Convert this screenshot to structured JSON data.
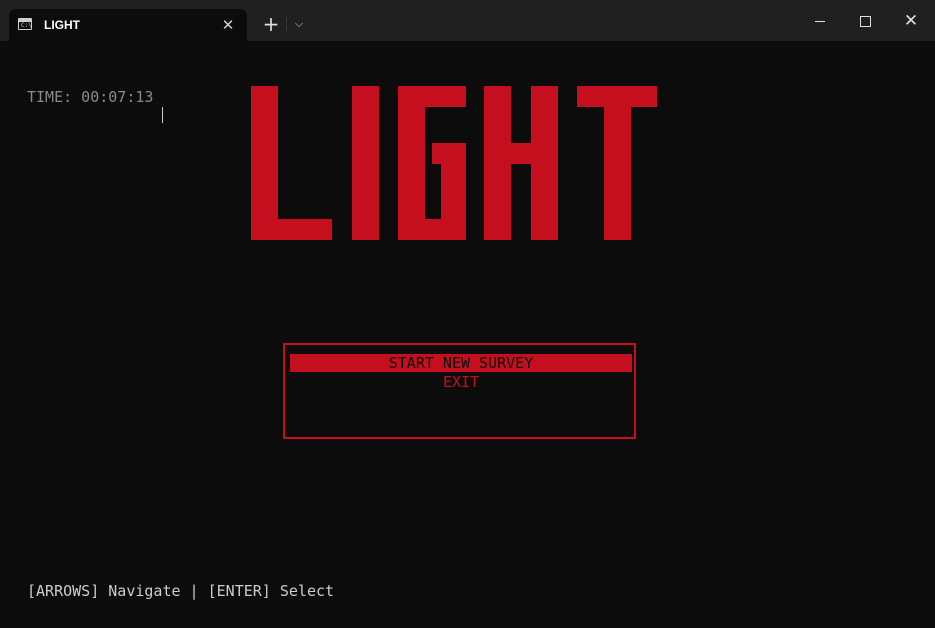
{
  "window": {
    "tab_title": "LIGHT",
    "tab_icon": "terminal-icon",
    "tab_icon_glyph": "C:\\",
    "close_tab_glyph": "✕",
    "new_tab_glyph": "+",
    "dropdown_glyph": "⌵",
    "minimize_icon": "minimize-icon",
    "maximize_icon": "maximize-icon",
    "close_glyph": "✕"
  },
  "hud": {
    "time_label": "TIME: 00:07:13"
  },
  "title_banner": {
    "text": "LIGHT",
    "color": "#c50f1f"
  },
  "menu": {
    "items": [
      {
        "label": "START NEW SURVEY",
        "selected": true
      },
      {
        "label": "EXIT",
        "selected": false
      }
    ],
    "accent": "#c50f1f"
  },
  "footer": {
    "hint": "[ARROWS] Navigate | [ENTER] Select"
  },
  "colors": {
    "background": "#0c0c0c",
    "titlebar": "#202020",
    "accent_red": "#c50f1f"
  }
}
